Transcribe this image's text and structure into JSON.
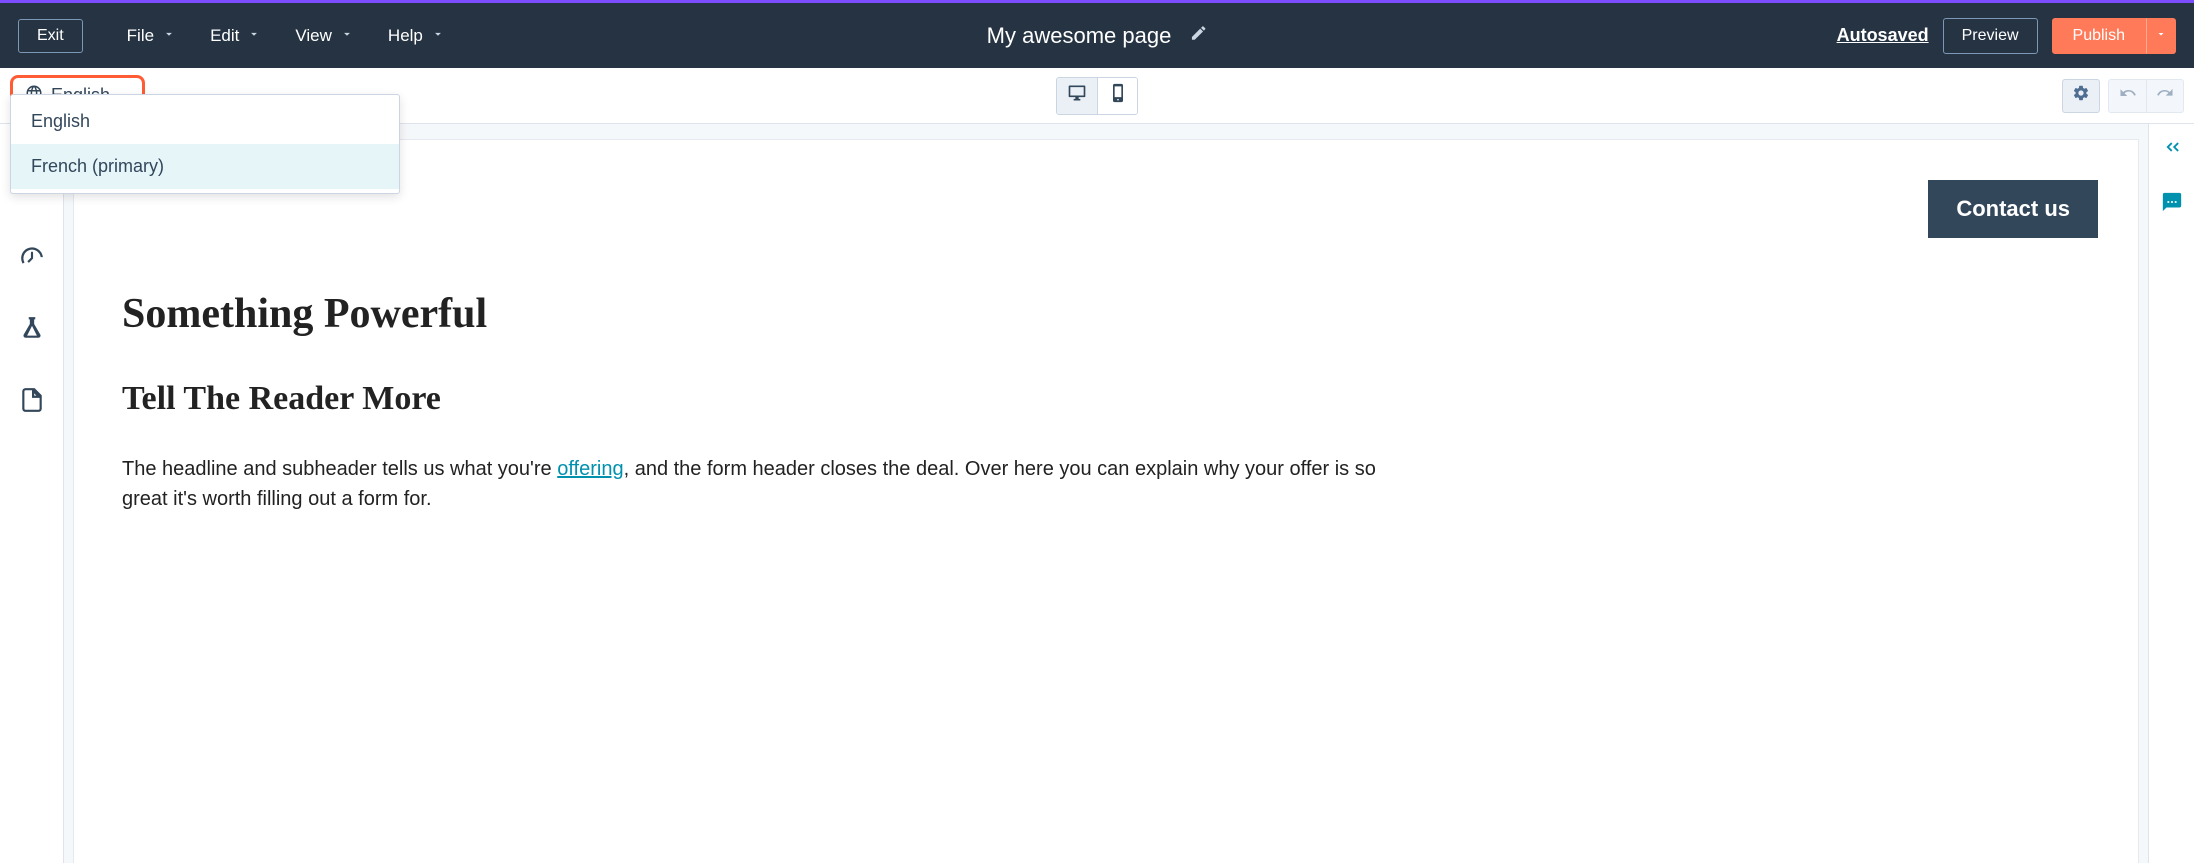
{
  "topbar": {
    "exit": "Exit",
    "menus": [
      "File",
      "Edit",
      "View",
      "Help"
    ],
    "title": "My awesome page",
    "autosaved": "Autosaved",
    "preview": "Preview",
    "publish": "Publish"
  },
  "language": {
    "current": "English",
    "options": [
      "English",
      "French (primary)"
    ]
  },
  "content": {
    "contact_button": "Contact us",
    "heading": "Something Powerful",
    "subheading": "Tell The Reader More",
    "body_pre": "The headline and subheader tells us what you're ",
    "body_link": "offering",
    "body_post": ", and the form header closes the deal. Over here you can explain why your offer is so great it's worth filling out a form for."
  }
}
